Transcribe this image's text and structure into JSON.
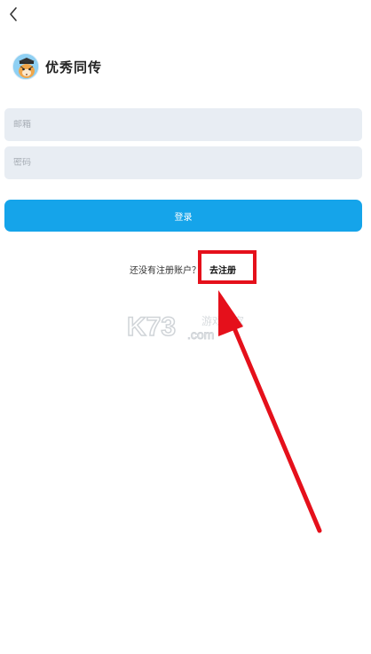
{
  "nav": {
    "back_icon": "chevron-left-icon"
  },
  "brand": {
    "name": "优秀同传",
    "logo_icon": "tiger-mascot-logo"
  },
  "form": {
    "email_placeholder": "邮箱",
    "email_value": "",
    "password_placeholder": "密码",
    "password_value": "",
    "login_label": "登录"
  },
  "register": {
    "prompt": "还没有注册账户？",
    "link_label": "去注册"
  },
  "overlay": {
    "watermark_main": "K73",
    "watermark_sub": "游戏之家",
    "watermark_domain": ".com",
    "highlight_color": "#e5101b"
  },
  "colors": {
    "primary": "#15a4ea",
    "input_bg": "#e8edf3",
    "annotation_red": "#e5101b"
  }
}
